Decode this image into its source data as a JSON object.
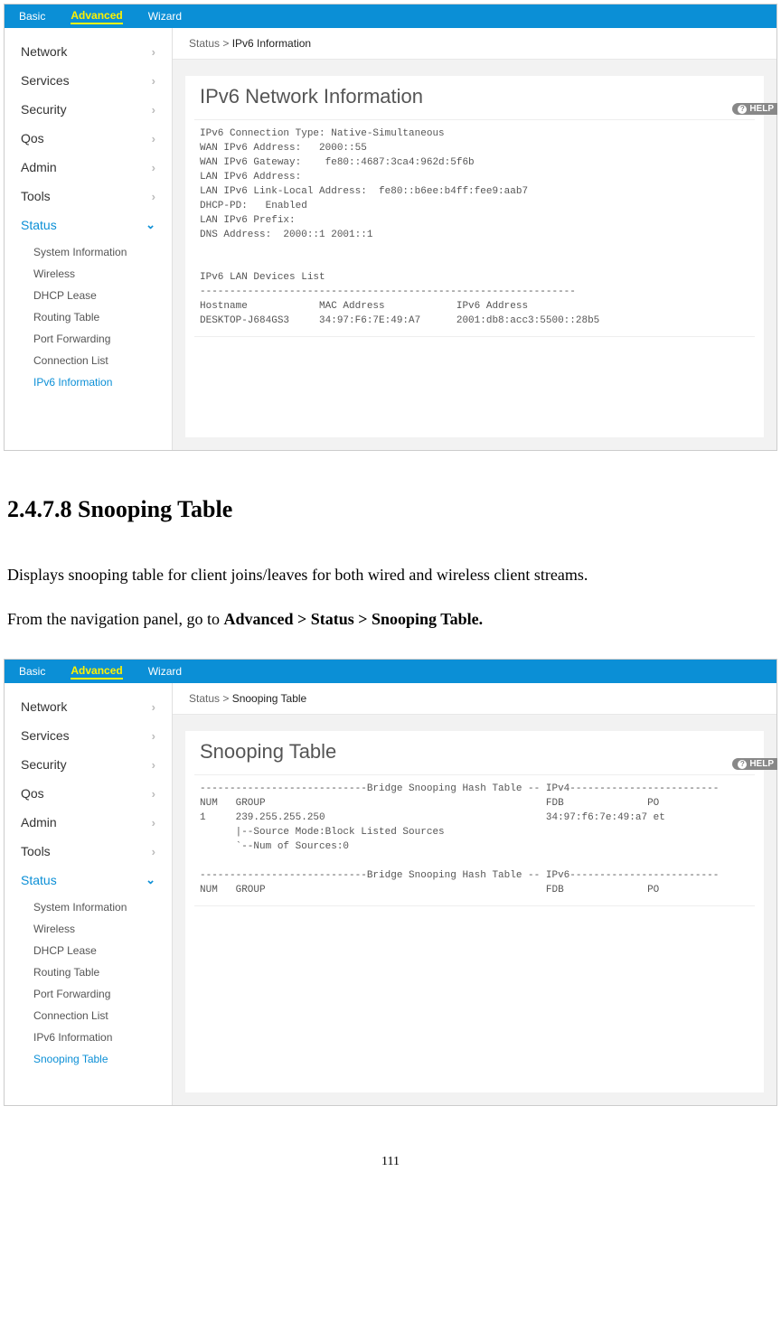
{
  "topnav": {
    "basic": "Basic",
    "advanced": "Advanced",
    "wizard": "Wizard"
  },
  "sidenav": {
    "network": "Network",
    "services": "Services",
    "security": "Security",
    "qos": "Qos",
    "admin": "Admin",
    "tools": "Tools",
    "status": "Status"
  },
  "subnav1": {
    "sysinfo": "System Information",
    "wireless": "Wireless",
    "dhcp": "DHCP Lease",
    "routing": "Routing Table",
    "portfwd": "Port Forwarding",
    "connlist": "Connection List",
    "ipv6": "IPv6 Information"
  },
  "subnav2": {
    "sysinfo": "System Information",
    "wireless": "Wireless",
    "dhcp": "DHCP Lease",
    "routing": "Routing Table",
    "portfwd": "Port Forwarding",
    "connlist": "Connection List",
    "ipv6": "IPv6 Information",
    "snooping": "Snooping Table"
  },
  "breadcrumb1": {
    "prefix": "Status > ",
    "current": "IPv6 Information"
  },
  "breadcrumb2": {
    "prefix": "Status > ",
    "current": "Snooping Table"
  },
  "panel1": {
    "title": "IPv6 Network Information",
    "body": "IPv6 Connection Type: Native-Simultaneous\nWAN IPv6 Address:   2000::55\nWAN IPv6 Gateway:    fe80::4687:3ca4:962d:5f6b\nLAN IPv6 Address:\nLAN IPv6 Link-Local Address:  fe80::b6ee:b4ff:fee9:aab7\nDHCP-PD:   Enabled\nLAN IPv6 Prefix:\nDNS Address:  2000::1 2001::1\n\n\nIPv6 LAN Devices List\n---------------------------------------------------------------\nHostname            MAC Address            IPv6 Address\nDESKTOP-J684GS3     34:97:F6:7E:49:A7      2001:db8:acc3:5500::28b5"
  },
  "panel2": {
    "title": "Snooping Table",
    "body": "----------------------------Bridge Snooping Hash Table -- IPv4-------------------------\nNUM   GROUP                                               FDB              PO\n1     239.255.255.250                                     34:97:f6:7e:49:a7 et\n      |--Source Mode:Block Listed Sources\n      `--Num of Sources:0\n\n----------------------------Bridge Snooping Hash Table -- IPv6-------------------------\nNUM   GROUP                                               FDB              PO"
  },
  "help": "HELP",
  "doc": {
    "heading": "2.4.7.8 Snooping Table",
    "p1a": "Displays snooping table for client joins/leaves for both wired and wireless client streams.",
    "p2a": "From the navigation panel, go to ",
    "p2b": "Advanced > Status > Snooping Table."
  },
  "pagenum": "111"
}
